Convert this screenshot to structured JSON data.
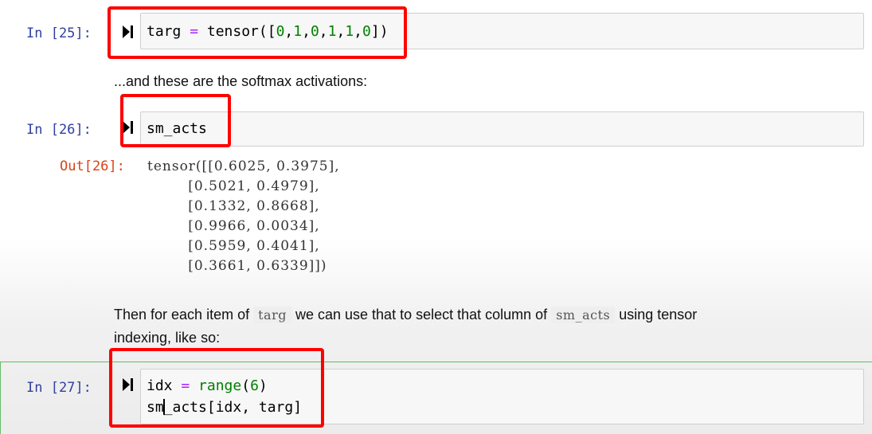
{
  "cells": [
    {
      "prompt": "In [25]:",
      "code": [
        "targ = tensor([0,1,0,1,1,0])"
      ]
    },
    {
      "prompt": "In [26]:",
      "code": [
        "sm_acts"
      ],
      "out_prompt": "Out[26]:",
      "output": [
        "tensor([[0.6025, 0.3975],",
        "        [0.5021, 0.4979],",
        "        [0.1332, 0.8668],",
        "        [0.9966, 0.0034],",
        "        [0.5959, 0.4041],",
        "        [0.3661, 0.6339]])"
      ]
    },
    {
      "prompt": "In [27]:",
      "code": [
        "idx = range(6)",
        "sm_acts[idx, targ]"
      ]
    }
  ],
  "markdown": {
    "softmax_text": "...and these are the softmax activations:",
    "then_prefix": "Then for each item of",
    "then_code1": "targ",
    "then_middle": "we can use that to select that column of",
    "then_code2": "sm_acts",
    "then_suffix": "using tensor",
    "then_line2": "indexing, like so:"
  },
  "icons": {
    "run": "run-cell-icon"
  },
  "colors": {
    "highlight": "#ff0000",
    "prompt_in": "#303f9f",
    "prompt_out": "#d84315",
    "keyword": "#008000"
  }
}
